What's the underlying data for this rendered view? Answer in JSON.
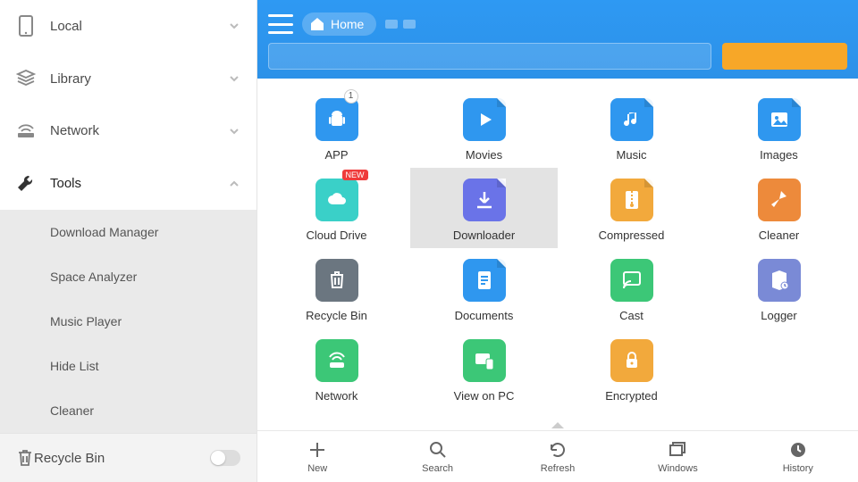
{
  "colors": {
    "blue": "#2f97ef",
    "orange": "#f7a728",
    "teal": "#3ad0c8",
    "green": "#3cc777",
    "purple": "#6a73e8",
    "amber": "#f2a93c",
    "dark": "#6b7680"
  },
  "sidebar": {
    "items": [
      {
        "label": "Local",
        "icon": "phone-icon",
        "expanded": false
      },
      {
        "label": "Library",
        "icon": "stack-icon",
        "expanded": false
      },
      {
        "label": "Network",
        "icon": "router-icon",
        "expanded": false
      },
      {
        "label": "Tools",
        "icon": "wrench-icon",
        "expanded": true
      }
    ],
    "tools_sub": [
      {
        "label": "Download Manager"
      },
      {
        "label": "Space Analyzer"
      },
      {
        "label": "Music Player"
      },
      {
        "label": "Hide List"
      },
      {
        "label": "Cleaner"
      }
    ],
    "recycle": {
      "label": "Recycle Bin",
      "on": false
    }
  },
  "topbar": {
    "home": "Home"
  },
  "grid": [
    {
      "label": "APP",
      "badge": "1",
      "color": "#2f97ef",
      "icon": "android-icon"
    },
    {
      "label": "Movies",
      "color": "#2f97ef",
      "icon": "play-icon",
      "folded": true
    },
    {
      "label": "Music",
      "color": "#2f97ef",
      "icon": "note-icon",
      "folded": true
    },
    {
      "label": "Images",
      "color": "#2f97ef",
      "icon": "picture-icon",
      "folded": true
    },
    {
      "label": "Cloud Drive",
      "new": "NEW",
      "color": "#3ad0c8",
      "icon": "cloud-icon"
    },
    {
      "label": "Downloader",
      "selected": true,
      "color": "#6a73e8",
      "icon": "download-icon",
      "folded": true
    },
    {
      "label": "Compressed",
      "color": "#f2a93c",
      "icon": "zip-icon",
      "folded": true
    },
    {
      "label": "Cleaner",
      "color": "#ed8a3b",
      "icon": "broom-icon"
    },
    {
      "label": "Recycle Bin",
      "color": "#6b7680",
      "icon": "trash-icon"
    },
    {
      "label": "Documents",
      "color": "#2f97ef",
      "icon": "doc-icon",
      "folded": true
    },
    {
      "label": "Cast",
      "color": "#3cc777",
      "icon": "cast-icon"
    },
    {
      "label": "Logger",
      "color": "#7a8ad6",
      "icon": "log-icon"
    },
    {
      "label": "Network",
      "color": "#3cc777",
      "icon": "net-icon"
    },
    {
      "label": "View on PC",
      "color": "#3cc777",
      "icon": "pc-icon"
    },
    {
      "label": "Encrypted",
      "color": "#f2a93c",
      "icon": "lock-icon"
    }
  ],
  "bottom": [
    {
      "label": "New",
      "icon": "plus-icon"
    },
    {
      "label": "Search",
      "icon": "search-icon"
    },
    {
      "label": "Refresh",
      "icon": "refresh-icon"
    },
    {
      "label": "Windows",
      "icon": "windows-icon"
    },
    {
      "label": "History",
      "icon": "clock-icon"
    }
  ]
}
